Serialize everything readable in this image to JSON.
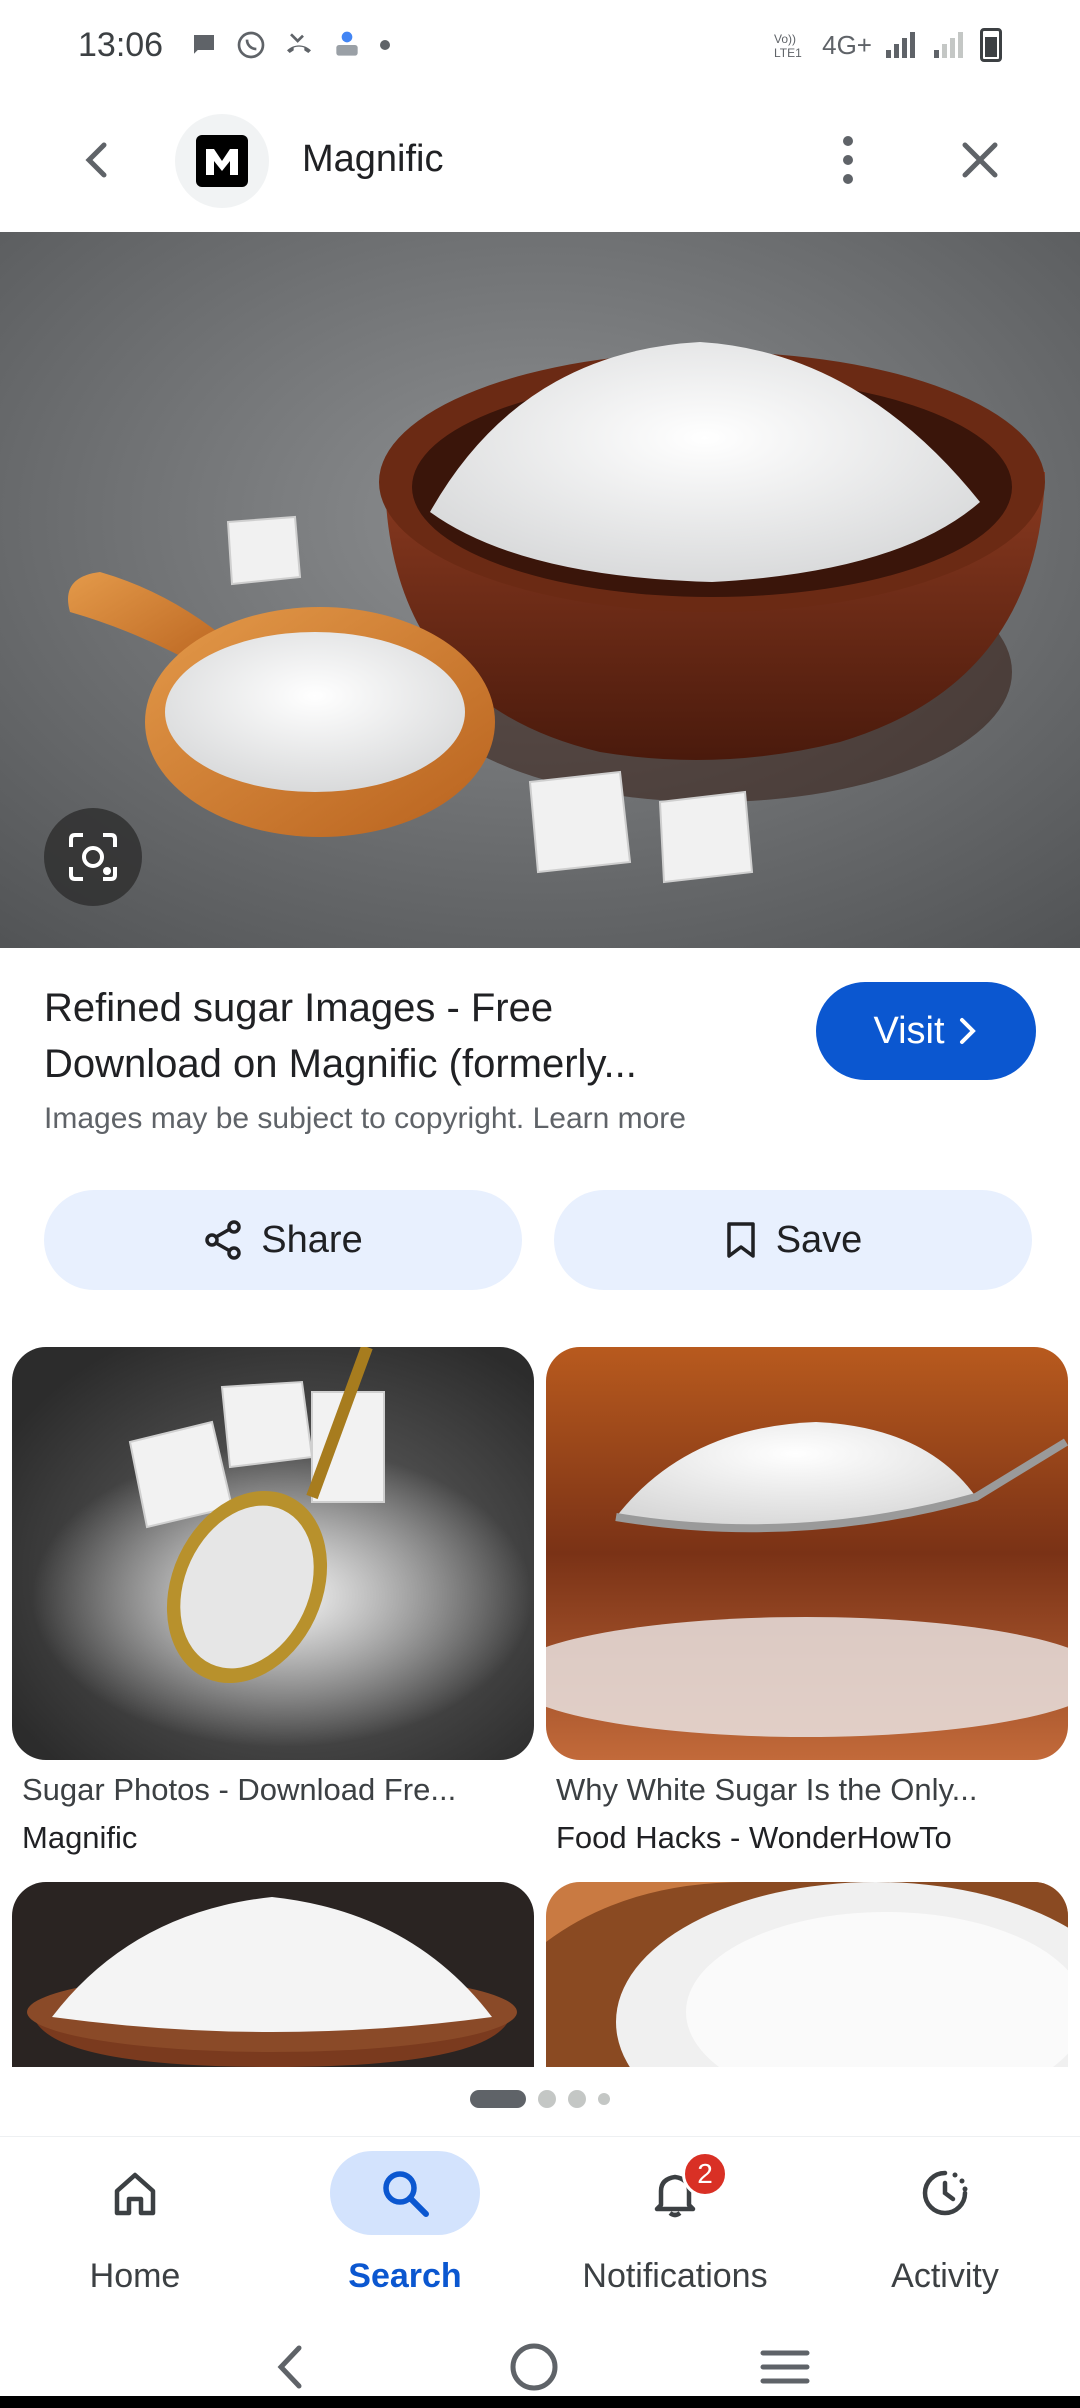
{
  "status_bar": {
    "time": "13:06",
    "network": "4G+"
  },
  "header": {
    "site_name": "Magnific"
  },
  "result": {
    "title_line1": "Refined sugar Images - Free",
    "title_line2": "Download on Magnific (formerly...",
    "visit_label": "Visit",
    "copyright_note": "Images may be subject to copyright. Learn more"
  },
  "actions": {
    "share_label": "Share",
    "save_label": "Save"
  },
  "related": [
    {
      "caption": "Sugar Photos - Download Fre...",
      "source": "Magnific"
    },
    {
      "caption": "Why White Sugar Is the Only...",
      "source": "Food Hacks - WonderHowTo"
    }
  ],
  "nav": {
    "home": "Home",
    "search": "Search",
    "notifications": "Notifications",
    "notifications_badge": "2",
    "activity": "Activity"
  },
  "colors": {
    "accent": "#0b57d0",
    "chip_bg": "#e8f0fe",
    "badge": "#d93025"
  }
}
